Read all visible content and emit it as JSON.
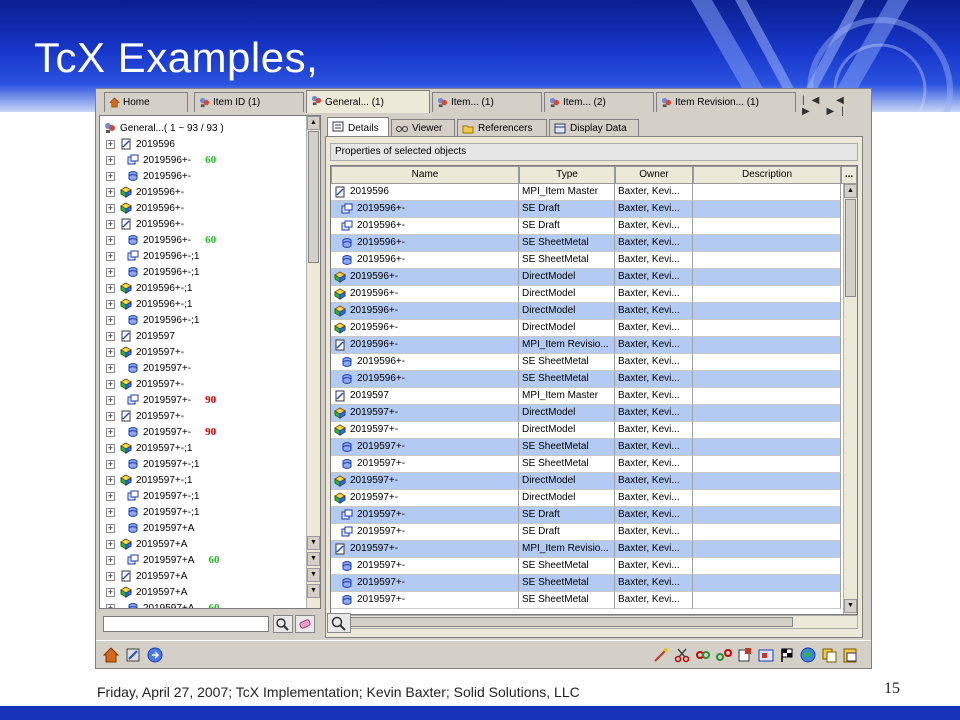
{
  "slide": {
    "title": "TcX Examples,",
    "footer": "Friday, April 27, 2007; TcX Implementation; Kevin Baxter; Solid Solutions, LLC",
    "page_number": "15"
  },
  "top_tabs": [
    {
      "label": "Home",
      "icon": "home-icon"
    },
    {
      "label": "Item ID (1)",
      "icon": "search-people-icon"
    },
    {
      "label": "General... (1)",
      "icon": "search-people-icon"
    },
    {
      "label": "Item... (1)",
      "icon": "search-people-icon"
    },
    {
      "label": "Item... (2)",
      "icon": "search-people-icon"
    },
    {
      "label": "Item Revision... (1)",
      "icon": "search-people-icon"
    }
  ],
  "nav_arrows": "|◀ ◀ ▶ ▶|",
  "tree": {
    "root": "General...( 1 ~ 93 / 93 )",
    "items": [
      {
        "label": "2019596",
        "icon": "item-master-icon",
        "indent": 0,
        "badge": ""
      },
      {
        "label": "2019596+-",
        "icon": "draft-icon",
        "indent": 1,
        "badge": "60"
      },
      {
        "label": "2019596+-",
        "icon": "sheetmetal-icon",
        "indent": 1,
        "badge": ""
      },
      {
        "label": "2019596+-",
        "icon": "directmodel-icon",
        "indent": 0,
        "badge": ""
      },
      {
        "label": "2019596+-",
        "icon": "directmodel-icon",
        "indent": 0,
        "badge": ""
      },
      {
        "label": "2019596+-",
        "icon": "item-master-icon",
        "indent": 0,
        "badge": ""
      },
      {
        "label": "2019596+-",
        "icon": "sheetmetal-icon",
        "indent": 1,
        "badge": "60"
      },
      {
        "label": "2019596+-;1",
        "icon": "draft-icon",
        "indent": 1,
        "badge": ""
      },
      {
        "label": "2019596+-;1",
        "icon": "sheetmetal-icon",
        "indent": 1,
        "badge": ""
      },
      {
        "label": "2019596+-;1",
        "icon": "directmodel-icon",
        "indent": 0,
        "badge": ""
      },
      {
        "label": "2019596+-;1",
        "icon": "directmodel-icon",
        "indent": 0,
        "badge": ""
      },
      {
        "label": "2019596+-;1",
        "icon": "sheetmetal-icon",
        "indent": 1,
        "badge": ""
      },
      {
        "label": "2019597",
        "icon": "item-master-icon",
        "indent": 0,
        "badge": ""
      },
      {
        "label": "2019597+-",
        "icon": "directmodel-icon",
        "indent": 0,
        "badge": ""
      },
      {
        "label": "2019597+-",
        "icon": "sheetmetal-icon",
        "indent": 1,
        "badge": ""
      },
      {
        "label": "2019597+-",
        "icon": "directmodel-icon",
        "indent": 0,
        "badge": ""
      },
      {
        "label": "2019597+-",
        "icon": "draft-icon",
        "indent": 1,
        "badge": "90"
      },
      {
        "label": "2019597+-",
        "icon": "item-master-icon",
        "indent": 0,
        "badge": ""
      },
      {
        "label": "2019597+-",
        "icon": "sheetmetal-icon",
        "indent": 1,
        "badge": "90"
      },
      {
        "label": "2019597+-;1",
        "icon": "directmodel-icon",
        "indent": 0,
        "badge": ""
      },
      {
        "label": "2019597+-;1",
        "icon": "sheetmetal-icon",
        "indent": 1,
        "badge": ""
      },
      {
        "label": "2019597+-;1",
        "icon": "directmodel-icon",
        "indent": 0,
        "badge": ""
      },
      {
        "label": "2019597+-;1",
        "icon": "draft-icon",
        "indent": 1,
        "badge": ""
      },
      {
        "label": "2019597+-;1",
        "icon": "sheetmetal-icon",
        "indent": 1,
        "badge": ""
      },
      {
        "label": "2019597+A",
        "icon": "sheetmetal-icon",
        "indent": 1,
        "badge": ""
      },
      {
        "label": "2019597+A",
        "icon": "directmodel-icon",
        "indent": 0,
        "badge": ""
      },
      {
        "label": "2019597+A",
        "icon": "draft-icon",
        "indent": 1,
        "badge": "60"
      },
      {
        "label": "2019597+A",
        "icon": "item-master-icon",
        "indent": 0,
        "badge": ""
      },
      {
        "label": "2019597+A",
        "icon": "directmodel-icon",
        "indent": 0,
        "badge": ""
      },
      {
        "label": "2019597+A",
        "icon": "sheetmetal-icon",
        "indent": 1,
        "badge": "60"
      }
    ]
  },
  "sub_tabs": [
    {
      "label": "Details",
      "icon": "details-icon"
    },
    {
      "label": "Viewer",
      "icon": "glasses-icon"
    },
    {
      "label": "Referencers",
      "icon": "folder-icon"
    },
    {
      "label": "Display Data",
      "icon": "table-icon"
    }
  ],
  "props_title": "Properties of selected objects",
  "columns": [
    "Name",
    "Type",
    "Owner",
    "Description",
    "..."
  ],
  "rows": [
    {
      "name": "2019596",
      "type": "MPI_Item Master",
      "owner": "Baxter, Kevi...",
      "icon": "item-master-icon",
      "indent": 0,
      "selected": false
    },
    {
      "name": "2019596+-",
      "type": "SE Draft",
      "owner": "Baxter, Kevi...",
      "icon": "draft-icon",
      "indent": 1,
      "selected": true
    },
    {
      "name": "2019596+-",
      "type": "SE Draft",
      "owner": "Baxter, Kevi...",
      "icon": "draft-icon",
      "indent": 1,
      "selected": false
    },
    {
      "name": "2019596+-",
      "type": "SE SheetMetal",
      "owner": "Baxter, Kevi...",
      "icon": "sheetmetal-icon",
      "indent": 1,
      "selected": true
    },
    {
      "name": "2019596+-",
      "type": "SE SheetMetal",
      "owner": "Baxter, Kevi...",
      "icon": "sheetmetal-icon",
      "indent": 1,
      "selected": false
    },
    {
      "name": "2019596+-",
      "type": "DirectModel",
      "owner": "Baxter, Kevi...",
      "icon": "directmodel-icon",
      "indent": 0,
      "selected": true
    },
    {
      "name": "2019596+-",
      "type": "DirectModel",
      "owner": "Baxter, Kevi...",
      "icon": "directmodel-icon",
      "indent": 0,
      "selected": false
    },
    {
      "name": "2019596+-",
      "type": "DirectModel",
      "owner": "Baxter, Kevi...",
      "icon": "directmodel-icon",
      "indent": 0,
      "selected": true
    },
    {
      "name": "2019596+-",
      "type": "DirectModel",
      "owner": "Baxter, Kevi...",
      "icon": "directmodel-icon",
      "indent": 0,
      "selected": false
    },
    {
      "name": "2019596+-",
      "type": "MPI_Item Revisio...",
      "owner": "Baxter, Kevi...",
      "icon": "item-master-icon",
      "indent": 0,
      "selected": true
    },
    {
      "name": "2019596+-",
      "type": "SE SheetMetal",
      "owner": "Baxter, Kevi...",
      "icon": "sheetmetal-icon",
      "indent": 1,
      "selected": false
    },
    {
      "name": "2019596+-",
      "type": "SE SheetMetal",
      "owner": "Baxter, Kevi...",
      "icon": "sheetmetal-icon",
      "indent": 1,
      "selected": true
    },
    {
      "name": "2019597",
      "type": "MPI_Item Master",
      "owner": "Baxter, Kevi...",
      "icon": "item-master-icon",
      "indent": 0,
      "selected": false
    },
    {
      "name": "2019597+-",
      "type": "DirectModel",
      "owner": "Baxter, Kevi...",
      "icon": "directmodel-icon",
      "indent": 0,
      "selected": true
    },
    {
      "name": "2019597+-",
      "type": "DirectModel",
      "owner": "Baxter, Kevi...",
      "icon": "directmodel-icon",
      "indent": 0,
      "selected": false
    },
    {
      "name": "2019597+-",
      "type": "SE SheetMetal",
      "owner": "Baxter, Kevi...",
      "icon": "sheetmetal-icon",
      "indent": 1,
      "selected": true
    },
    {
      "name": "2019597+-",
      "type": "SE SheetMetal",
      "owner": "Baxter, Kevi...",
      "icon": "sheetmetal-icon",
      "indent": 1,
      "selected": false
    },
    {
      "name": "2019597+-",
      "type": "DirectModel",
      "owner": "Baxter, Kevi...",
      "icon": "directmodel-icon",
      "indent": 0,
      "selected": true
    },
    {
      "name": "2019597+-",
      "type": "DirectModel",
      "owner": "Baxter, Kevi...",
      "icon": "directmodel-icon",
      "indent": 0,
      "selected": false
    },
    {
      "name": "2019597+-",
      "type": "SE Draft",
      "owner": "Baxter, Kevi...",
      "icon": "draft-icon",
      "indent": 1,
      "selected": true
    },
    {
      "name": "2019597+-",
      "type": "SE Draft",
      "owner": "Baxter, Kevi...",
      "icon": "draft-icon",
      "indent": 1,
      "selected": false
    },
    {
      "name": "2019597+-",
      "type": "MPI_Item Revisio...",
      "owner": "Baxter, Kevi...",
      "icon": "item-master-icon",
      "indent": 0,
      "selected": true
    },
    {
      "name": "2019597+-",
      "type": "SE SheetMetal",
      "owner": "Baxter, Kevi...",
      "icon": "sheetmetal-icon",
      "indent": 1,
      "selected": false
    },
    {
      "name": "2019597+-",
      "type": "SE SheetMetal",
      "owner": "Baxter, Kevi...",
      "icon": "sheetmetal-icon",
      "indent": 1,
      "selected": true
    },
    {
      "name": "2019597+-",
      "type": "SE SheetMetal",
      "owner": "Baxter, Kevi...",
      "icon": "sheetmetal-icon",
      "indent": 1,
      "selected": false
    }
  ],
  "toolbar_icons": [
    "home-tree-icon",
    "properties-icon",
    "navigate-icon",
    "check-icon",
    "cut-icon",
    "link-icon",
    "unlink-icon",
    "new-item-icon",
    "revise-icon",
    "flag-icon",
    "globe-icon",
    "copy-icon",
    "paste-icon"
  ],
  "colors": {
    "selected_row": "#b3cbf3",
    "badge_green": "#22bb22",
    "badge_red": "#cc0000",
    "banner_blue": "#1533b8"
  }
}
